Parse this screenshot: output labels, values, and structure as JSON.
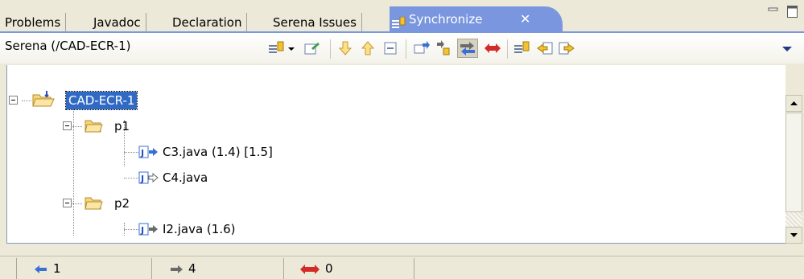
{
  "tabs": [
    {
      "label": "Problems"
    },
    {
      "label": "Javadoc"
    },
    {
      "label": "Declaration"
    },
    {
      "label": "Serena Issues"
    },
    {
      "label": "Synchronize",
      "active": true
    }
  ],
  "view": {
    "title": "Serena (/CAD-ECR-1)"
  },
  "tree": {
    "root": {
      "label": "CAD-ECR-1"
    },
    "folders": [
      {
        "label": "p1",
        "files": [
          {
            "label": "C3.java (1.4) [1.5]",
            "change": "incoming"
          },
          {
            "label": "C4.java",
            "change": "outgoing"
          }
        ]
      },
      {
        "label": "p2",
        "files": [
          {
            "label": "I2.java (1.6)",
            "change": "outgoing"
          }
        ]
      }
    ]
  },
  "status": {
    "incoming_count": "1",
    "outgoing_count": "4",
    "conflict_count": "0"
  },
  "colors": {
    "active_tab": "#7a96df",
    "selection": "#316ac5",
    "incoming": "#3a6fd8",
    "outgoing": "#6a6a6a",
    "conflict": "#d42a2a"
  }
}
